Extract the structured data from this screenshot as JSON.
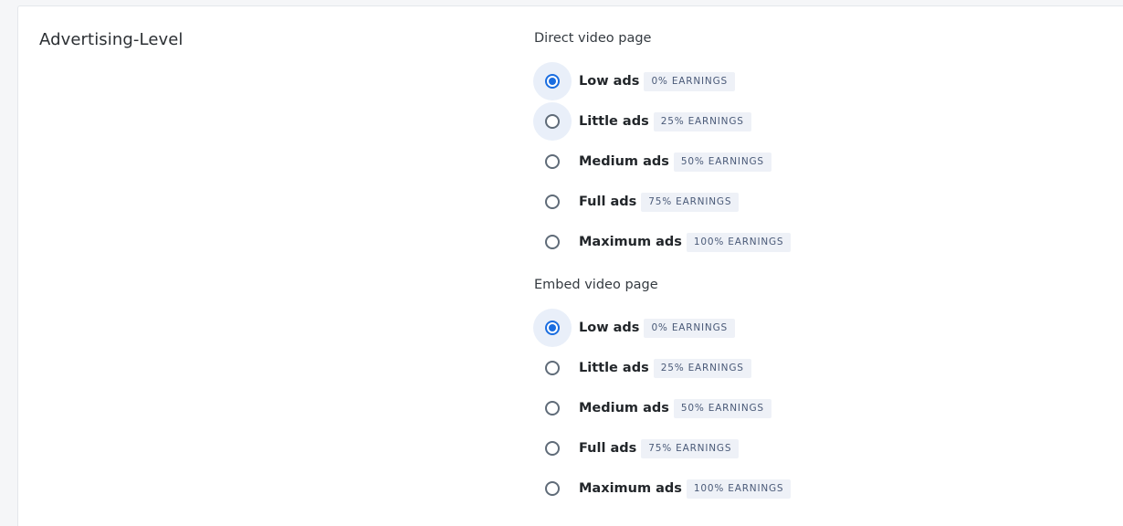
{
  "section": {
    "title": "Advertising-Level"
  },
  "direct": {
    "label": "Direct video page",
    "options": [
      {
        "label": "Low ads",
        "badge": "0% EARNINGS",
        "checked": true
      },
      {
        "label": "Little ads",
        "badge": "25% EARNINGS",
        "checked": false
      },
      {
        "label": "Medium ads",
        "badge": "50% EARNINGS",
        "checked": false
      },
      {
        "label": "Full ads",
        "badge": "75% EARNINGS",
        "checked": false
      },
      {
        "label": "Maximum ads",
        "badge": "100% EARNINGS",
        "checked": false
      }
    ]
  },
  "embed": {
    "label": "Embed video page",
    "options": [
      {
        "label": "Low ads",
        "badge": "0% EARNINGS",
        "checked": true
      },
      {
        "label": "Little ads",
        "badge": "25% EARNINGS",
        "checked": false
      },
      {
        "label": "Medium ads",
        "badge": "50% EARNINGS",
        "checked": false
      },
      {
        "label": "Full ads",
        "badge": "75% EARNINGS",
        "checked": false
      },
      {
        "label": "Maximum ads",
        "badge": "100% EARNINGS",
        "checked": false
      }
    ]
  },
  "colors": {
    "accent": "#1a6de0",
    "badge_bg": "#eef1f7",
    "badge_text": "#4a5a78"
  }
}
